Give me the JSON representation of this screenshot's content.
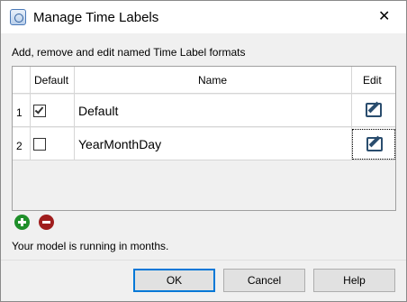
{
  "window": {
    "title": "Manage Time Labels",
    "close_glyph": "✕"
  },
  "instruction": "Add, remove and edit named Time Label formats",
  "grid": {
    "headers": {
      "default": "Default",
      "name": "Name",
      "edit": "Edit"
    },
    "rows": [
      {
        "num": "1",
        "default_checked": true,
        "name": "Default",
        "edit_icon": "edit-icon"
      },
      {
        "num": "2",
        "default_checked": false,
        "name": "YearMonthDay",
        "edit_icon": "edit-icon",
        "focused": true
      }
    ]
  },
  "actions": {
    "add_icon": "plus-circle-icon",
    "add_color": "#1f8f2a",
    "remove_icon": "minus-circle-icon",
    "remove_color": "#9f1d1d"
  },
  "status_text": "Your model is running in months.",
  "buttons": {
    "ok": "OK",
    "cancel": "Cancel",
    "help": "Help"
  },
  "colors": {
    "default_button_border": "#0078d7"
  }
}
